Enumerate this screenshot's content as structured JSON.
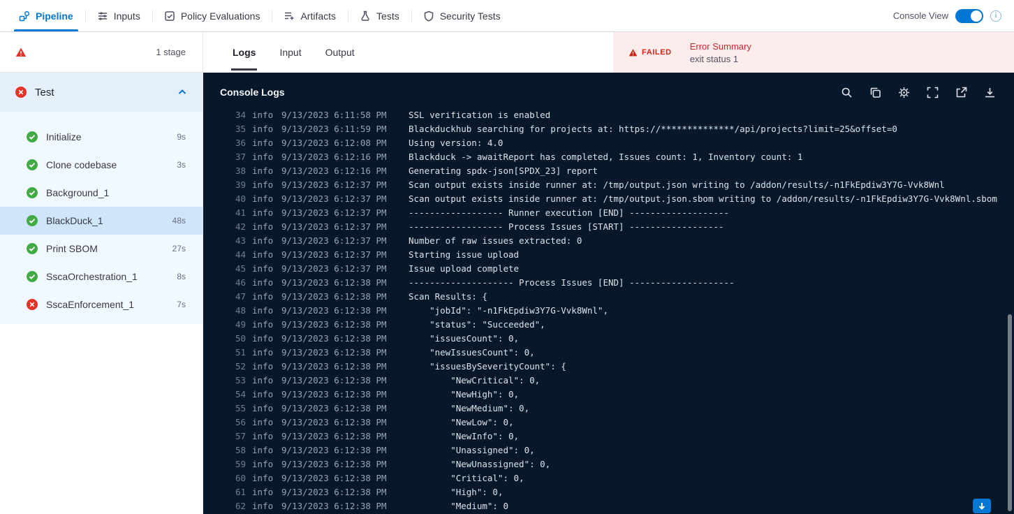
{
  "top_nav": {
    "tabs": [
      {
        "label": "Pipeline"
      },
      {
        "label": "Inputs"
      },
      {
        "label": "Policy Evaluations"
      },
      {
        "label": "Artifacts"
      },
      {
        "label": "Tests"
      },
      {
        "label": "Security Tests"
      }
    ],
    "console_view_label": "Console View"
  },
  "sidebar": {
    "stage_count_label": "1 stage",
    "stage": {
      "name": "Test",
      "status": "failed"
    },
    "steps": [
      {
        "name": "Initialize",
        "duration": "9s",
        "status": "success"
      },
      {
        "name": "Clone codebase",
        "duration": "3s",
        "status": "success"
      },
      {
        "name": "Background_1",
        "duration": "",
        "status": "success"
      },
      {
        "name": "BlackDuck_1",
        "duration": "48s",
        "status": "success",
        "selected": true
      },
      {
        "name": "Print SBOM",
        "duration": "27s",
        "status": "success"
      },
      {
        "name": "SscaOrchestration_1",
        "duration": "8s",
        "status": "success"
      },
      {
        "name": "SscaEnforcement_1",
        "duration": "7s",
        "status": "failed"
      }
    ]
  },
  "main": {
    "tabs": [
      {
        "label": "Logs",
        "active": true
      },
      {
        "label": "Input"
      },
      {
        "label": "Output"
      }
    ],
    "error_summary": {
      "badge": "FAILED",
      "title": "Error Summary",
      "message": "exit status 1"
    }
  },
  "console": {
    "title": "Console Logs",
    "lines": [
      {
        "n": 34,
        "lvl": "info",
        "t": "9/13/2023 6:11:58 PM",
        "m": "SSL verification is enabled"
      },
      {
        "n": 35,
        "lvl": "info",
        "t": "9/13/2023 6:11:59 PM",
        "m": "Blackduckhub searching for projects at: https://**************/api/projects?limit=25&offset=0"
      },
      {
        "n": 36,
        "lvl": "info",
        "t": "9/13/2023 6:12:08 PM",
        "m": "Using version: 4.0"
      },
      {
        "n": 37,
        "lvl": "info",
        "t": "9/13/2023 6:12:16 PM",
        "m": "Blackduck -> awaitReport has completed, Issues count: 1, Inventory count: 1"
      },
      {
        "n": 38,
        "lvl": "info",
        "t": "9/13/2023 6:12:16 PM",
        "m": "Generating spdx-json[SPDX_23] report"
      },
      {
        "n": 39,
        "lvl": "info",
        "t": "9/13/2023 6:12:37 PM",
        "m": "Scan output exists inside runner at: /tmp/output.json writing to /addon/results/-n1FkEpdiw3Y7G-Vvk8Wnl"
      },
      {
        "n": 40,
        "lvl": "info",
        "t": "9/13/2023 6:12:37 PM",
        "m": "Scan output exists inside runner at: /tmp/output.json.sbom writing to /addon/results/-n1FkEpdiw3Y7G-Vvk8Wnl.sbom"
      },
      {
        "n": 41,
        "lvl": "info",
        "t": "9/13/2023 6:12:37 PM",
        "m": "------------------ Runner execution [END] -------------------"
      },
      {
        "n": 42,
        "lvl": "info",
        "t": "9/13/2023 6:12:37 PM",
        "m": "------------------ Process Issues [START] ------------------"
      },
      {
        "n": 43,
        "lvl": "info",
        "t": "9/13/2023 6:12:37 PM",
        "m": "Number of raw issues extracted: 0"
      },
      {
        "n": 44,
        "lvl": "info",
        "t": "9/13/2023 6:12:37 PM",
        "m": "Starting issue upload"
      },
      {
        "n": 45,
        "lvl": "info",
        "t": "9/13/2023 6:12:37 PM",
        "m": "Issue upload complete"
      },
      {
        "n": 46,
        "lvl": "info",
        "t": "9/13/2023 6:12:38 PM",
        "m": "-------------------- Process Issues [END] --------------------"
      },
      {
        "n": 47,
        "lvl": "info",
        "t": "9/13/2023 6:12:38 PM",
        "m": "Scan Results: {"
      },
      {
        "n": 48,
        "lvl": "info",
        "t": "9/13/2023 6:12:38 PM",
        "m": "    \"jobId\": \"-n1FkEpdiw3Y7G-Vvk8Wnl\","
      },
      {
        "n": 49,
        "lvl": "info",
        "t": "9/13/2023 6:12:38 PM",
        "m": "    \"status\": \"Succeeded\","
      },
      {
        "n": 50,
        "lvl": "info",
        "t": "9/13/2023 6:12:38 PM",
        "m": "    \"issuesCount\": 0,"
      },
      {
        "n": 51,
        "lvl": "info",
        "t": "9/13/2023 6:12:38 PM",
        "m": "    \"newIssuesCount\": 0,"
      },
      {
        "n": 52,
        "lvl": "info",
        "t": "9/13/2023 6:12:38 PM",
        "m": "    \"issuesBySeverityCount\": {"
      },
      {
        "n": 53,
        "lvl": "info",
        "t": "9/13/2023 6:12:38 PM",
        "m": "        \"NewCritical\": 0,"
      },
      {
        "n": 54,
        "lvl": "info",
        "t": "9/13/2023 6:12:38 PM",
        "m": "        \"NewHigh\": 0,"
      },
      {
        "n": 55,
        "lvl": "info",
        "t": "9/13/2023 6:12:38 PM",
        "m": "        \"NewMedium\": 0,"
      },
      {
        "n": 56,
        "lvl": "info",
        "t": "9/13/2023 6:12:38 PM",
        "m": "        \"NewLow\": 0,"
      },
      {
        "n": 57,
        "lvl": "info",
        "t": "9/13/2023 6:12:38 PM",
        "m": "        \"NewInfo\": 0,"
      },
      {
        "n": 58,
        "lvl": "info",
        "t": "9/13/2023 6:12:38 PM",
        "m": "        \"Unassigned\": 0,"
      },
      {
        "n": 59,
        "lvl": "info",
        "t": "9/13/2023 6:12:38 PM",
        "m": "        \"NewUnassigned\": 0,"
      },
      {
        "n": 60,
        "lvl": "info",
        "t": "9/13/2023 6:12:38 PM",
        "m": "        \"Critical\": 0,"
      },
      {
        "n": 61,
        "lvl": "info",
        "t": "9/13/2023 6:12:38 PM",
        "m": "        \"High\": 0,"
      },
      {
        "n": 62,
        "lvl": "info",
        "t": "9/13/2023 6:12:38 PM",
        "m": "        \"Medium\": 0"
      }
    ]
  },
  "colors": {
    "accent": "#0278d5",
    "success": "#42ab45",
    "error": "#e43326",
    "console_bg": "#07182b",
    "error_bg": "#fcedec"
  }
}
